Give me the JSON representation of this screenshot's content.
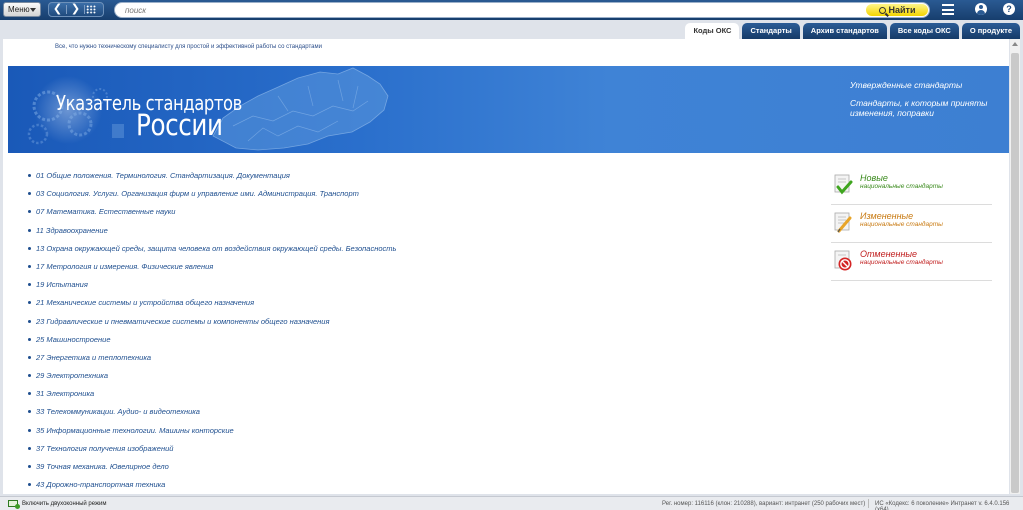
{
  "topbar": {
    "menu_label": "Меню",
    "search_placeholder": "поиск",
    "find_label": "Найти"
  },
  "tabs": [
    {
      "label": "Коды ОКС",
      "active": true
    },
    {
      "label": "Стандарты",
      "active": false
    },
    {
      "label": "Архив стандартов",
      "active": false
    },
    {
      "label": "Все коды ОКС",
      "active": false
    },
    {
      "label": "О продукте",
      "active": false
    }
  ],
  "page": {
    "tagline": "Все, что нужно техническому специалисту для простой и эффективной работы со стандартами",
    "banner": {
      "title_line1": "Указатель стандартов",
      "title_line2": "России",
      "right_line1": "Утвержденные стандарты",
      "right_line2": "Стандарты, к которым приняты изменения, поправки"
    },
    "oks_items": [
      "01 Общие положения. Терминология. Стандартизация. Документация",
      "03 Социология. Услуги. Организация фирм и управление ими. Администрация. Транспорт",
      "07 Математика. Естественные науки",
      "11 Здравоохранение",
      "13 Охрана окружающей среды, защита человека от воздействия окружающей среды. Безопасность",
      "17 Метрология и измерения. Физические явления",
      "19 Испытания",
      "21 Механические системы и устройства общего назначения",
      "23 Гидравлические и пневматические системы и компоненты общего назначения",
      "25 Машиностроение",
      "27 Энергетика и теплотехника",
      "29 Электротехника",
      "31 Электроника",
      "33 Телекоммуникации. Аудио- и видеотехника",
      "35 Информационные технологии. Машины конторские",
      "37 Технология получения изображений",
      "39 Точная механика. Ювелирное дело",
      "43 Дорожно-транспортная техника"
    ],
    "side": [
      {
        "title": "Новые",
        "subtitle": "национальные стандарты",
        "color": "#3a8a1c",
        "icon": "check-document-icon"
      },
      {
        "title": "Измененные",
        "subtitle": "национальные стандарты",
        "color": "#c87a12",
        "icon": "pencil-document-icon"
      },
      {
        "title": "Отмененные",
        "subtitle": "национальные стандарты",
        "color": "#c01e1e",
        "icon": "cancel-document-icon"
      }
    ]
  },
  "status": {
    "dual_mode": "Включить двухоконный режим",
    "reg_info": "Рег. номер: 116116 (клон: 210288), вариант: интранет (250 рабочих мест)",
    "version": "ИС «Кодекс: 6 поколение» Интранет v. 6.4.0.156 (x64)"
  }
}
